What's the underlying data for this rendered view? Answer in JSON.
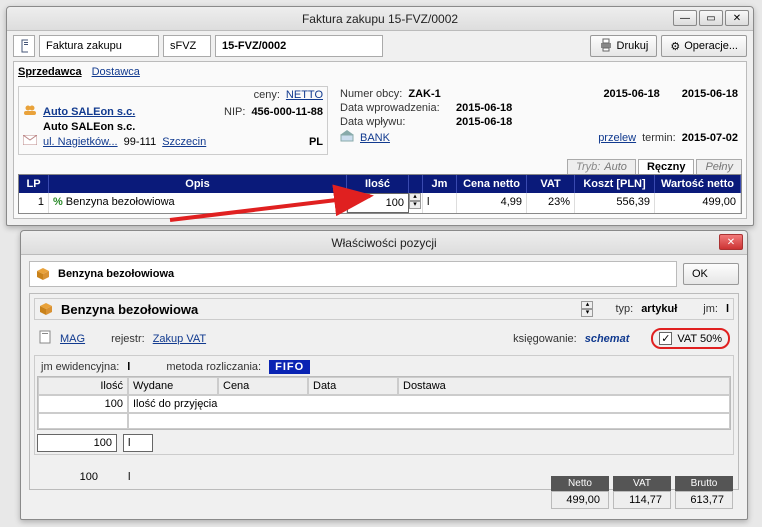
{
  "main_window": {
    "title": "Faktura zakupu 15-FVZ/0002",
    "toolbar": {
      "doc_type": "Faktura zakupu",
      "code_prefix_label": "sFVZ",
      "doc_number": "15-FVZ/0002",
      "print_label": "Drukuj",
      "operations_label": "Operacje..."
    },
    "tabs": {
      "seller": "Sprzedawca",
      "supplier": "Dostawca"
    },
    "prices": {
      "label": "ceny:",
      "value": "NETTO"
    },
    "seller": {
      "name1": "Auto SALEon s.c.",
      "nip_label": "NIP:",
      "nip": "456-000-11-88",
      "name2": "Auto SALEon s.c.",
      "street": "ul. Nagietków...",
      "postcode": "99-111",
      "city": "Szczecin",
      "country": "PL"
    },
    "meta": {
      "foreign_no_label": "Numer obcy:",
      "foreign_no": "ZAK-1",
      "date1": "2015-06-18",
      "date2": "2015-06-18",
      "entry_date_label": "Data wprowadzenia:",
      "entry_date": "2015-06-18",
      "impact_date_label": "Data wpływu:",
      "impact_date": "2015-06-18",
      "bank_label": "BANK",
      "payment": "przelew",
      "term_label": "termin:",
      "term": "2015-07-02"
    },
    "mini_tabs": {
      "prefix": "Tryb:",
      "auto": "Auto",
      "manual": "Ręczny",
      "full": "Pełny"
    },
    "grid": {
      "head": {
        "lp": "LP",
        "opis": "Opis",
        "ilosc": "Ilość",
        "jm": "Jm",
        "cena": "Cena netto",
        "vat": "VAT",
        "koszt": "Koszt [PLN]",
        "wart": "Wartość netto"
      },
      "row": {
        "lp": "1",
        "opis": "Benzyna bezołowiowa",
        "ilosc": "100",
        "jm": "l",
        "cena": "4,99",
        "vat": "23%",
        "koszt": "556,39",
        "wart": "499,00"
      }
    }
  },
  "props_window": {
    "title": "Właściwości pozycji",
    "item_name_short": "Benzyna bezołowiowa",
    "ok": "OK",
    "item_name_full": "Benzyna bezołowiowa",
    "type_label": "typ:",
    "type_value": "artykuł",
    "jm_label": "jm:",
    "jm_value": "l",
    "store_code_label": "MAG",
    "register_label": "rejestr:",
    "register_value": "Zakup VAT",
    "posting_label": "księgowanie:",
    "posting_value": "schemat",
    "vat50_label": "VAT 50%",
    "vat50_checked": "✓",
    "jm_ev_label": "jm ewidencyjna:",
    "jm_ev_value": "l",
    "method_label": "metoda rozliczania:",
    "method_badge": "FIFO",
    "inner_grid": {
      "head": {
        "ilosc": "Ilość",
        "wydane": "Wydane",
        "cena": "Cena",
        "data": "Data",
        "dostawa": "Dostawa"
      },
      "row1_ilosc": "100",
      "row1_label": "Ilość do przyjęcia"
    },
    "footer_qty": "100",
    "footer_unit": "l",
    "totals": {
      "netto_label": "Netto",
      "netto": "499,00",
      "vat_label": "VAT",
      "vat": "114,77",
      "brutto_label": "Brutto",
      "brutto": "613,77"
    }
  }
}
